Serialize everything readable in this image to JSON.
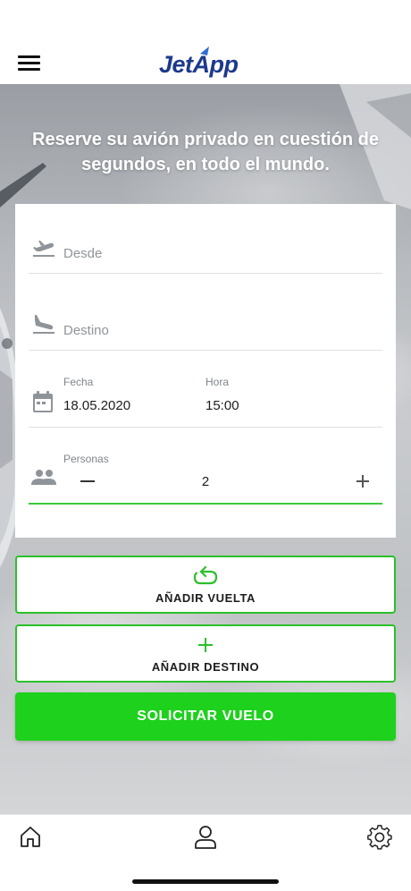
{
  "header": {
    "menu_icon": "hamburger-menu-icon",
    "logo_text": "JetApp",
    "brand_color": "#1c3a8c"
  },
  "hero": {
    "tagline": "Reserve su avión privado en cuestión de segundos, en todo el mundo."
  },
  "form": {
    "from_field": {
      "icon": "plane-takeoff-icon",
      "placeholder": "Desde",
      "value": ""
    },
    "to_field": {
      "icon": "plane-landing-icon",
      "placeholder": "Destino",
      "value": ""
    },
    "date_field": {
      "icon": "calendar-icon",
      "label": "Fecha",
      "value": "18.05.2020"
    },
    "time_field": {
      "label": "Hora",
      "value": "15:00"
    },
    "people_field": {
      "icon": "people-icon",
      "label": "Personas",
      "value": "2",
      "decrement_icon": "minus-icon",
      "increment_icon": "plus-icon"
    }
  },
  "actions": {
    "add_return": {
      "label": "AÑADIR VUELTA",
      "icon": "return-trip-icon"
    },
    "add_destination": {
      "label": "AÑADIR DESTINO",
      "icon": "plus-icon"
    },
    "request_flight": {
      "label": "SOLICITAR VUELO"
    }
  },
  "bottom_nav": {
    "items": [
      {
        "icon": "home-icon"
      },
      {
        "icon": "user-icon"
      },
      {
        "icon": "gear-icon"
      }
    ]
  },
  "colors": {
    "accent": "#1dd11d",
    "outline": "#2bc02b",
    "brand": "#1c3a8c"
  }
}
